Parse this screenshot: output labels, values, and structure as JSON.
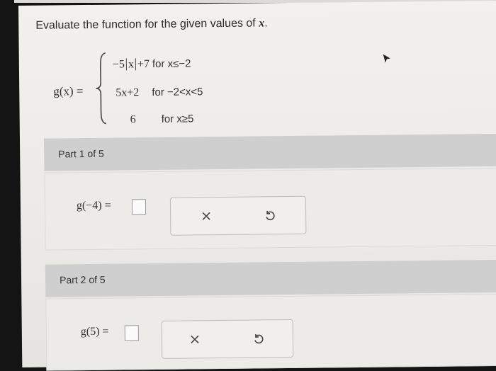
{
  "prompt": {
    "text": "Evaluate the function for the given values of ",
    "var": "x",
    "end": "."
  },
  "function": {
    "name": "g(x) =",
    "cases": [
      {
        "expr_pre": "−5",
        "expr_abs": "x",
        "expr_post": "+7",
        "cond": "for x≤−2"
      },
      {
        "expr_pre": "5x+2",
        "expr_abs": "",
        "expr_post": "",
        "cond": "for −2<x<5"
      },
      {
        "expr_pre": "6",
        "expr_abs": "",
        "expr_post": "",
        "cond": "for x≥5"
      }
    ]
  },
  "parts": [
    {
      "label": "Part 1 of 5",
      "expression": "g(−4) =",
      "answer": ""
    },
    {
      "label": "Part 2 of 5",
      "expression": "g(5) =",
      "answer": ""
    }
  ],
  "icons": {
    "clear": "close-icon",
    "reset": "undo-icon",
    "pointer": "cursor-icon"
  },
  "colors": {
    "header_bg": "#cfcfcf",
    "body_bg": "#ecebe8",
    "box_border": "#9a9a9a"
  }
}
